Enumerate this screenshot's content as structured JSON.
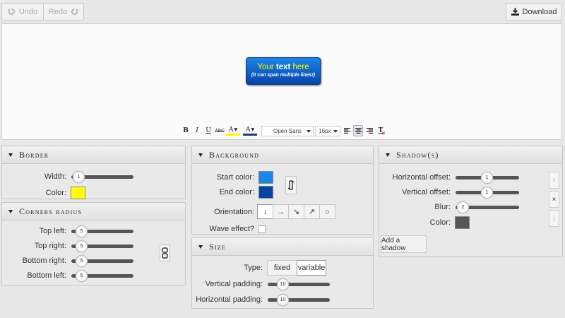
{
  "toolbar": {
    "undo": "Undo",
    "redo": "Redo",
    "download": "Download"
  },
  "preview": {
    "line1_prefix": "Your ",
    "line1_bold": "text",
    "line1_suffix": " here",
    "line2": "(it can span multiple lines!)"
  },
  "editor": {
    "bold": "B",
    "italic": "I",
    "underline": "U",
    "strike": "ABC",
    "font_color_glyph": "A",
    "bg_color_glyph": "A",
    "font": "Open Sans",
    "size": "16px",
    "clear": "T"
  },
  "border": {
    "title": "Border",
    "width_label": "Width:",
    "width_value": "1",
    "color_label": "Color:",
    "color": "#ffff00"
  },
  "corners": {
    "title": "Corners radius",
    "items": [
      {
        "label": "Top left:",
        "value": "5"
      },
      {
        "label": "Top right:",
        "value": "5"
      },
      {
        "label": "Bottom right:",
        "value": "5"
      },
      {
        "label": "Bottom left:",
        "value": "5"
      }
    ]
  },
  "background": {
    "title": "Background",
    "start_label": "Start color:",
    "start_color": "#1a86e6",
    "end_label": "End color:",
    "end_color": "#0743a6",
    "orientation_label": "Orientation:",
    "orientations": [
      "↓",
      "→",
      "↘",
      "↗",
      "○"
    ],
    "wave_label": "Wave effect?"
  },
  "size": {
    "title": "Size",
    "type_label": "Type:",
    "type_options": [
      "fixed",
      "variable"
    ],
    "vpad_label": "Vertical padding:",
    "vpad_value": "10",
    "hpad_label": "Horizontal padding:",
    "hpad_value": "10"
  },
  "shadow": {
    "title": "Shadow(s)",
    "hoff_label": "Horizontal offset:",
    "hoff_value": "1",
    "voff_label": "Vertical offset:",
    "voff_value": "1",
    "blur_label": "Blur:",
    "blur_value": "2",
    "color_label": "Color:",
    "color": "#555555",
    "add_label": "Add a shadow",
    "up": "↑",
    "remove": "×",
    "down": "↓"
  }
}
